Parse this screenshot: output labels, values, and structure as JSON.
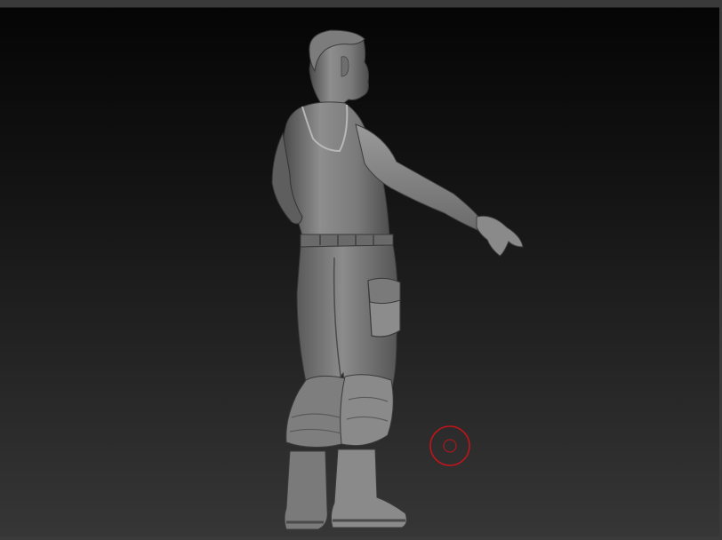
{
  "viewport": {
    "model": "sculpt-figure",
    "background_top": "#050505",
    "background_bottom": "#363636",
    "model_color": "#8a8a8a",
    "brush_color": "#c0141c"
  },
  "icons": {
    "brush_cursor": "brush-cursor-icon"
  }
}
